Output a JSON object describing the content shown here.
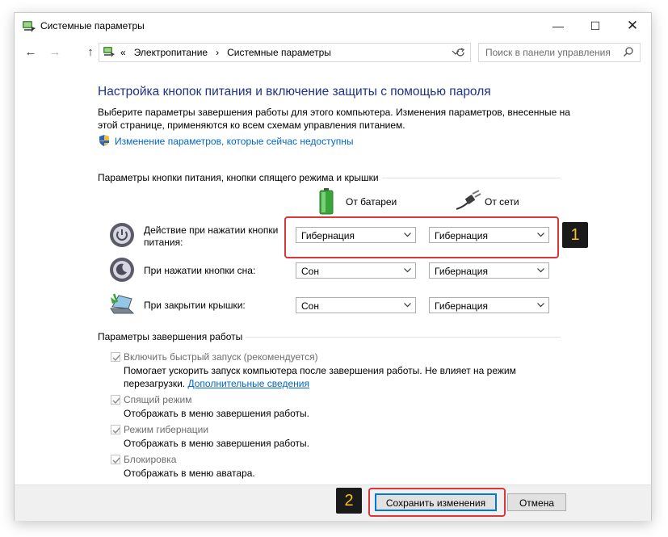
{
  "window": {
    "title": "Системные параметры",
    "controls": {
      "minimize": "—",
      "maximize": "☐",
      "close": "✕"
    }
  },
  "nav": {
    "back": "←",
    "forward": "→",
    "up": "↑",
    "breadcrumb": [
      "Электропитание",
      "Системные параметры"
    ],
    "breadcrumb_sep": "›",
    "breadcrumb_prefix": "«",
    "search_placeholder": "Поиск в панели управления"
  },
  "main": {
    "heading": "Настройка кнопок питания и включение защиты с помощью пароля",
    "description": "Выберите параметры завершения работы для этого компьютера. Изменения параметров, внесенные на этой странице, применяются ко всем схемам управления питанием.",
    "unavailable_link": "Изменение параметров, которые сейчас недоступны"
  },
  "power_buttons": {
    "section_title": "Параметры кнопки питания, кнопки спящего режима и крышки",
    "col_battery": "От батареи",
    "col_ac": "От сети",
    "rows": [
      {
        "icon": "power-button-icon",
        "label": "Действие при нажатии кнопки питания:",
        "battery": "Гибернация",
        "ac": "Гибернация"
      },
      {
        "icon": "sleep-button-icon",
        "label": "При нажатии кнопки сна:",
        "battery": "Сон",
        "ac": "Гибернация"
      },
      {
        "icon": "laptop-lid-icon",
        "label": "При закрытии крышки:",
        "battery": "Сон",
        "ac": "Гибернация"
      }
    ]
  },
  "shutdown": {
    "section_title": "Параметры завершения работы",
    "items": [
      {
        "title": "Включить быстрый запуск (рекомендуется)",
        "desc": "Помогает ускорить запуск компьютера после завершения работы. Не влияет на режим перезагрузки.",
        "link": "Дополнительные сведения",
        "checked": true
      },
      {
        "title": "Спящий режим",
        "desc": "Отображать в меню завершения работы.",
        "checked": true
      },
      {
        "title": "Режим гибернации",
        "desc": "Отображать в меню завершения работы.",
        "checked": true
      },
      {
        "title": "Блокировка",
        "desc": "Отображать в меню аватара.",
        "checked": true
      }
    ]
  },
  "footer": {
    "save": "Сохранить изменения",
    "cancel": "Отмена"
  },
  "annotations": {
    "badge1": "1",
    "badge2": "2",
    "highlight_color": "#d9373c"
  },
  "colors": {
    "heading": "#1e3287",
    "link": "#0066cc",
    "accent": "#0078d7"
  }
}
